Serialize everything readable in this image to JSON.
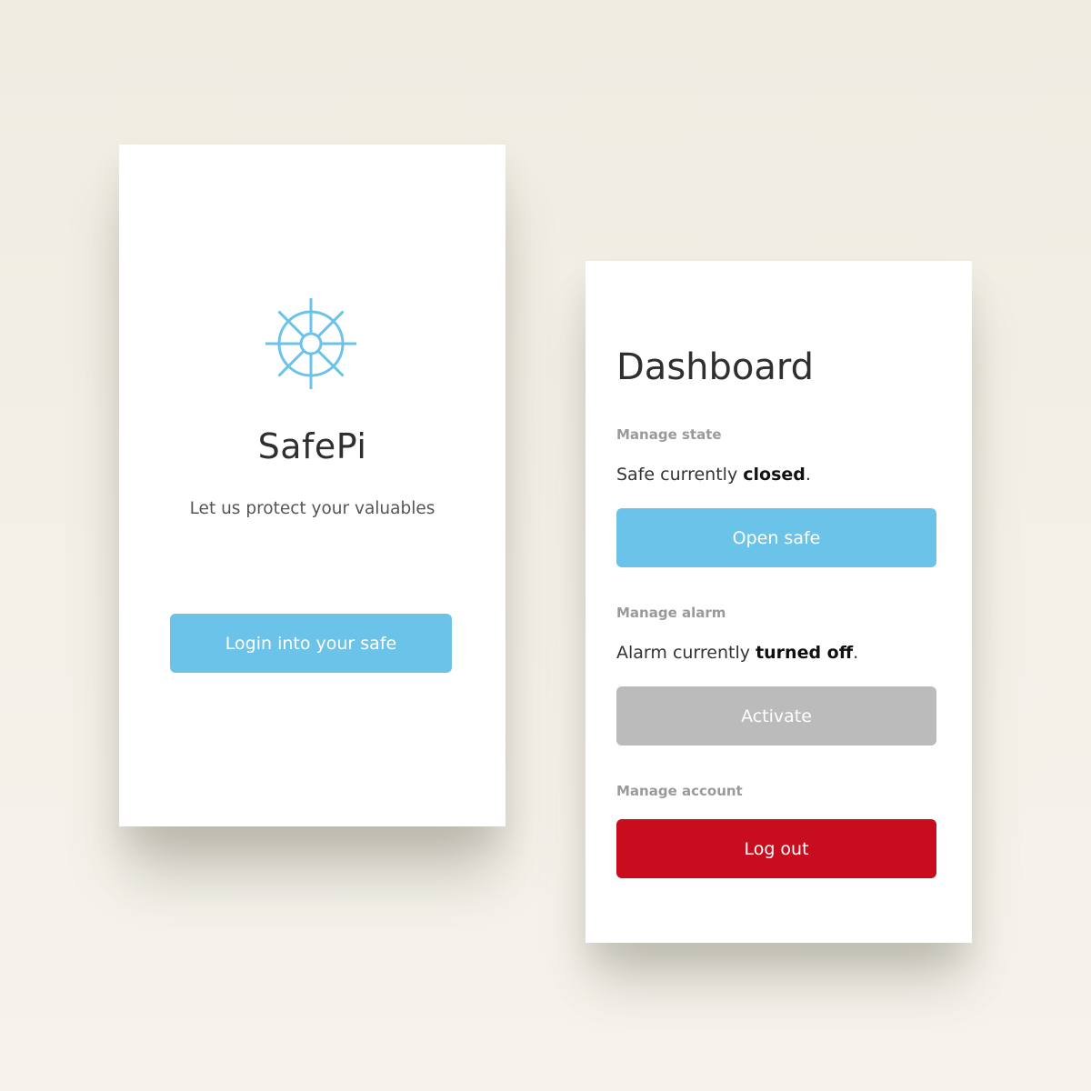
{
  "login": {
    "icon": "ship-wheel-icon",
    "app_name": "SafePi",
    "tagline": "Let us protect your valuables",
    "login_button": "Login into your safe"
  },
  "dashboard": {
    "title": "Dashboard",
    "state": {
      "label": "Manage state",
      "status_prefix": "Safe currently ",
      "status_value": "closed",
      "status_suffix": ".",
      "button": "Open safe"
    },
    "alarm": {
      "label": "Manage alarm",
      "status_prefix": "Alarm currently ",
      "status_value": "turned off",
      "status_suffix": ".",
      "button": "Activate"
    },
    "account": {
      "label": "Manage account",
      "button": "Log out"
    }
  },
  "colors": {
    "primary": "#6cc3ea",
    "disabled": "#bbbbbb",
    "danger": "#c80e1e",
    "background": "#f1eee6"
  }
}
